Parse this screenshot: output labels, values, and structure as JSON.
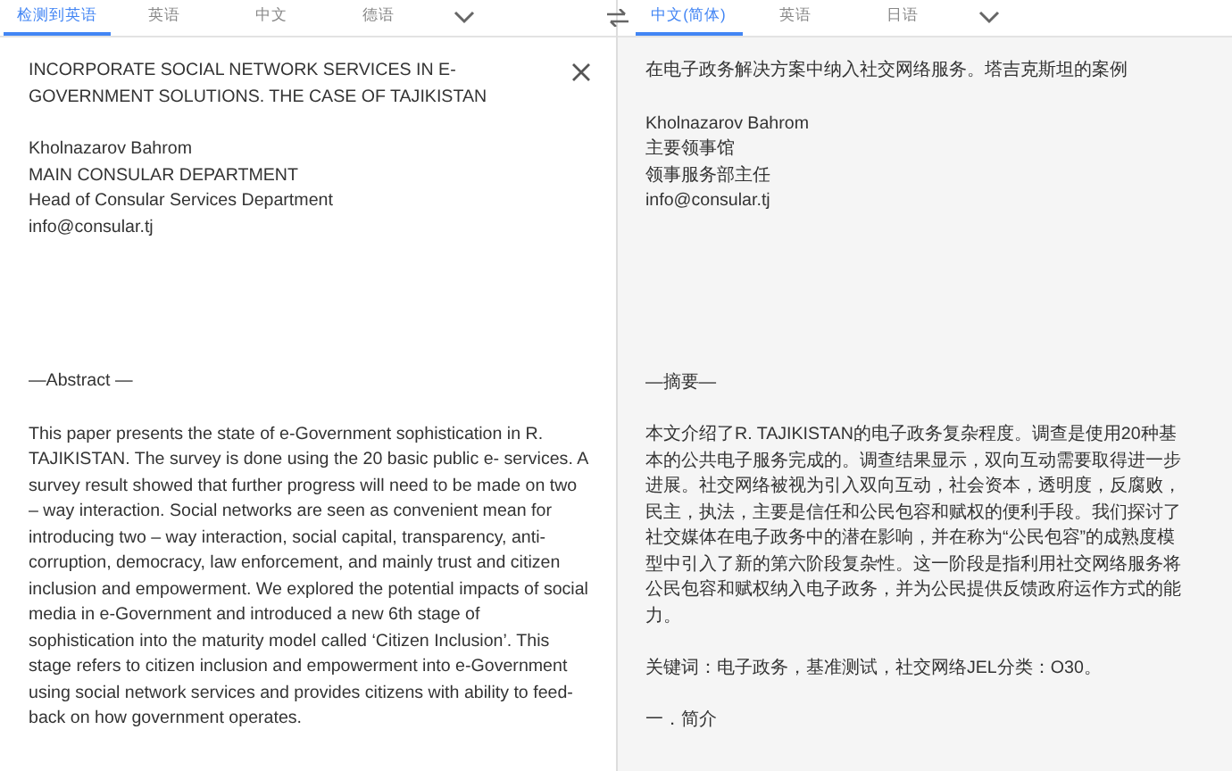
{
  "source_tabs": [
    {
      "label": "检测到英语",
      "selected": true
    },
    {
      "label": "英语",
      "selected": false
    },
    {
      "label": "中文",
      "selected": false
    },
    {
      "label": "德语",
      "selected": false
    }
  ],
  "target_tabs": [
    {
      "label": "中文(简体)",
      "selected": true
    },
    {
      "label": "英语",
      "selected": false
    },
    {
      "label": "日语",
      "selected": false
    }
  ],
  "source": {
    "title": "INCORPORATE SOCIAL NETWORK SERVICES IN E-GOVERNMENT SOLUTIONS. THE CASE OF TAJIKISTAN",
    "author_lines": [
      "Kholnazarov Bahrom",
      "MAIN CONSULAR DEPARTMENT",
      "Head of Consular Services Department",
      "info@consular.tj"
    ],
    "abstract_heading": "—Abstract —",
    "abstract": "This paper presents the state of e-Government sophistication in R. TAJIKISTAN. The survey is done using the 20 basic public e- services. A survey result showed that further progress will need to be made on two – way interaction. Social networks are seen as convenient mean for introducing two – way interaction, social capital, transparency, anti-corruption, democracy, law enforcement, and mainly trust and citizen inclusion and empowerment. We explored the potential impacts of social media in e-Government and introduced a new 6th stage of sophistication into the maturity model called ‘Citizen Inclusion’. This stage refers to citizen inclusion and empowerment into e-Government using social network services and provides citizens with ability to feed-back on how government operates."
  },
  "translation": {
    "title": "在电子政务解决方案中纳入社交网络服务。塔吉克斯坦的案例",
    "author_lines": [
      "Kholnazarov Bahrom",
      "主要领事馆",
      "领事服务部主任",
      "info@consular.tj"
    ],
    "abstract_heading": "—摘要—",
    "abstract": "本文介绍了R. TAJIKISTAN的电子政务复杂程度。调查是使用20种基本的公共电子服务完成的。调查结果显示，双向互动需要取得进一步进展。社交网络被视为引入双向互动，社会资本，透明度，反腐败，民主，执法，主要是信任和公民包容和赋权的便利手段。我们探讨了社交媒体在电子政务中的潜在影响，并在称为“公民包容”的成熟度模型中引入了新的第六阶段复杂性。这一阶段是指利用社交网络服务将公民包容和赋权纳入电子政务，并为公民提供反馈政府运作方式的能力。",
    "keywords": "关键词：电子政务，基准测试，社交网络JEL分类：O30。",
    "section_heading": "一．简介"
  }
}
